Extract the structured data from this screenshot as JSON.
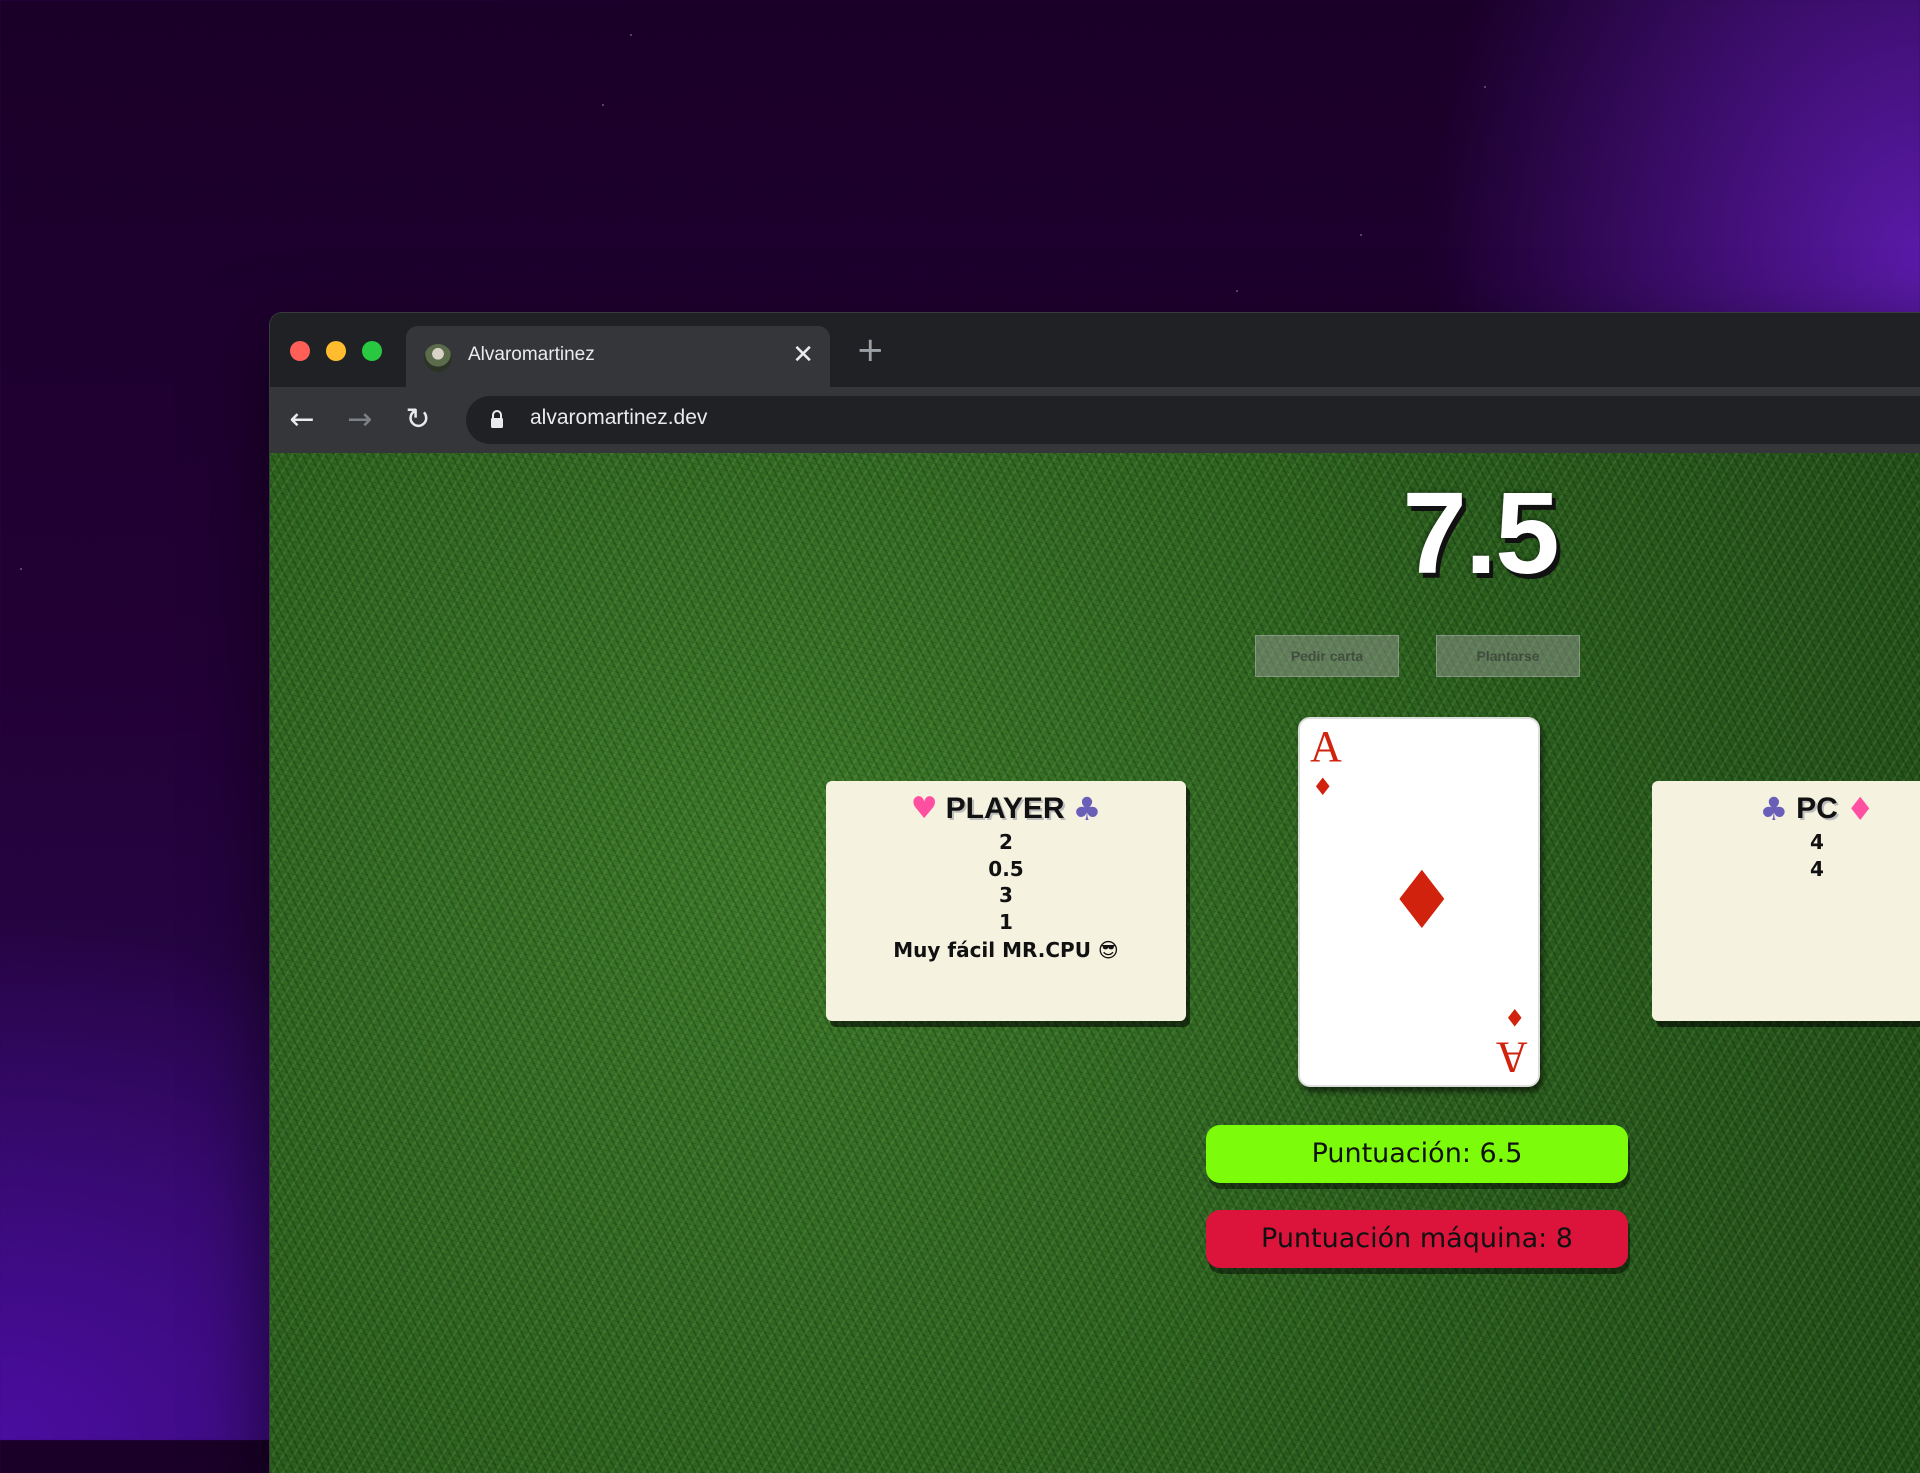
{
  "browser": {
    "tab_title": "Alvaromartinez",
    "tab_close": "✕",
    "new_tab": "+",
    "url": "alvaromartinez.dev",
    "back": "←",
    "forward": "→",
    "reload": "↻"
  },
  "game": {
    "title": "7.5",
    "controls": {
      "ask_card": "Pedir carta",
      "stand": "Plantarse"
    },
    "player_panel": {
      "name": "PLAYER",
      "left_suit": "♥",
      "right_suit": "♣",
      "cards": [
        "2",
        "0.5",
        "3",
        "1"
      ],
      "message": "Muy fácil MR.CPU 😎"
    },
    "pc_panel": {
      "name": "PC",
      "left_suit": "♣",
      "right_suit": "♦",
      "cards": [
        "4",
        "4"
      ]
    },
    "current_card": {
      "rank": "A",
      "suit": "♦",
      "color": "#d0220c"
    },
    "player_score": "Puntuación: 6.5",
    "cpu_score": "Puntuación máquina: 8"
  },
  "colors": {
    "player_score_bg": "#7cfc0a",
    "cpu_score_bg": "#dc143c",
    "panel_bg": "#f5f2df"
  }
}
